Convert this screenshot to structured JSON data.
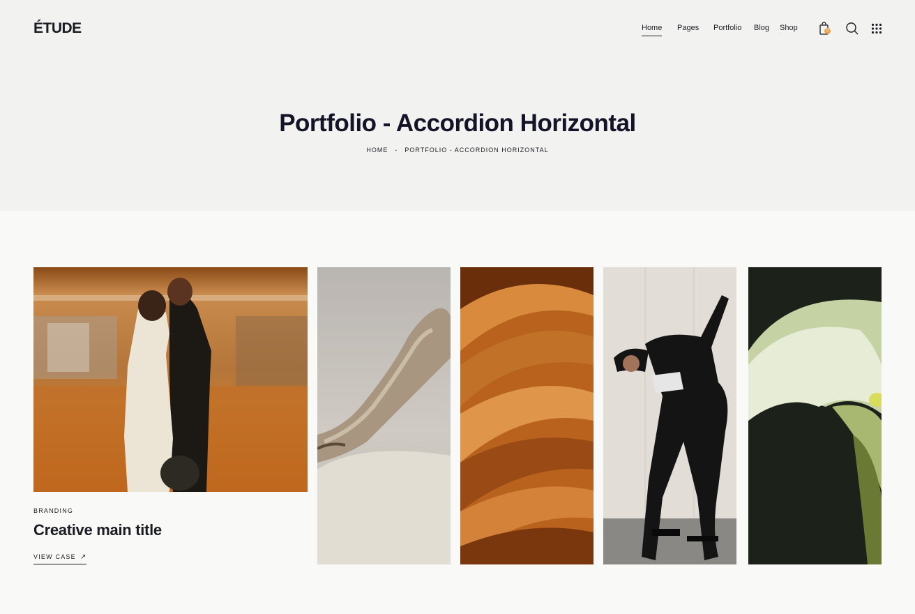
{
  "brand": {
    "logo": "ÉTUDE"
  },
  "nav": {
    "items": [
      {
        "label": "Home",
        "active": true
      },
      {
        "label": "Pages",
        "active": false
      },
      {
        "label": "Portfolio",
        "active": false
      },
      {
        "label": "Blog",
        "active": false
      },
      {
        "label": "Shop",
        "active": false
      }
    ],
    "cart_count": "0",
    "icons": [
      "shopping-bag-icon",
      "search-icon",
      "grid-menu-icon"
    ]
  },
  "header": {
    "title": "Portfolio - Accordion Horizontal",
    "breadcrumb": [
      "HOME",
      "-",
      "PORTFOLIO - ACCORDION HORIZONTAL"
    ]
  },
  "portfolio": {
    "active_item": {
      "category": "BRANDING",
      "title": "Creative main title",
      "link_label": "VIEW CASE",
      "link_icon": "arrow-up-right-icon"
    },
    "panels": [
      {
        "image": "couple-embracing-photo"
      },
      {
        "image": "driftwood-photo"
      },
      {
        "image": "orange-waves-photo"
      },
      {
        "image": "dancer-photo"
      },
      {
        "image": "calla-lily-photo"
      }
    ]
  },
  "colors": {
    "hero_bg": "#f2f3f0",
    "page_bg": "#f9f9f7",
    "text": "#1c1c24",
    "badge": "#e8a24e"
  }
}
